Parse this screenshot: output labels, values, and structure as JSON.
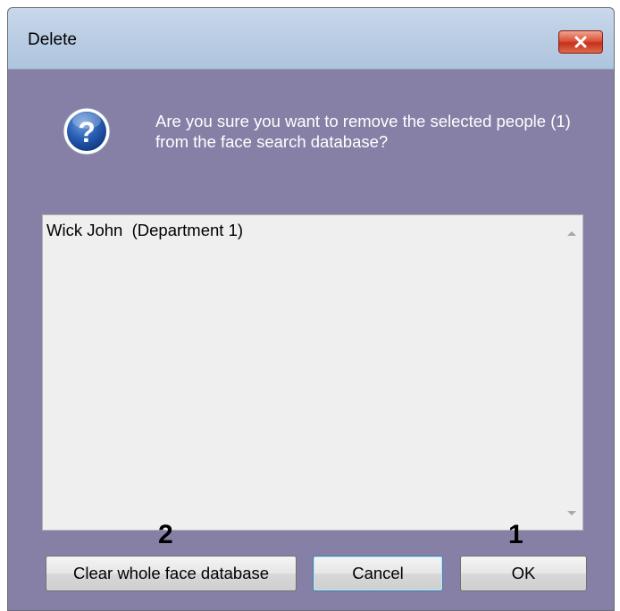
{
  "window": {
    "title": "Delete",
    "close_icon": "close-icon"
  },
  "dialog": {
    "icon": "question-icon",
    "message": "Are you sure you want to remove the selected people (1) from the face search database?"
  },
  "list": {
    "items": [
      "Wick John  (Department 1)"
    ]
  },
  "buttons": {
    "clear_label": "Clear whole face database",
    "cancel_label": "Cancel",
    "ok_label": "OK"
  },
  "annotations": {
    "marker_1": "1",
    "marker_2": "2"
  },
  "colors": {
    "dialog_background": "#8680a6",
    "titlebar": "#b9cce3",
    "close_button": "#c5301c",
    "list_background": "#efefef",
    "question_icon": "#1c4f9c"
  }
}
